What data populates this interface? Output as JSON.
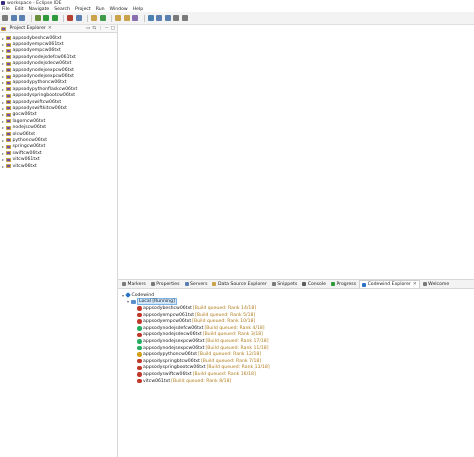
{
  "window": {
    "title": "workspace - Eclipse IDE"
  },
  "menu": [
    "File",
    "Edit",
    "Navigate",
    "Search",
    "Project",
    "Run",
    "Window",
    "Help"
  ],
  "toolbar": {
    "icons": [
      {
        "name": "new-icon",
        "color": "#7a7a7a"
      },
      {
        "name": "save-icon",
        "color": "#5a7fb0"
      },
      {
        "name": "save-all-icon",
        "color": "#5a7fb0"
      },
      {
        "name": "sep"
      },
      {
        "name": "debug-icon",
        "color": "#6b8e3a"
      },
      {
        "name": "run-icon",
        "color": "#2e9a3a"
      },
      {
        "name": "run-config-icon",
        "color": "#2e9a3a"
      },
      {
        "name": "sep"
      },
      {
        "name": "external-tools-icon",
        "color": "#b3402e"
      },
      {
        "name": "new-java-project-icon",
        "color": "#5a7fb0"
      },
      {
        "name": "sep"
      },
      {
        "name": "new-package-icon",
        "color": "#c9a24a"
      },
      {
        "name": "new-class-icon",
        "color": "#3f9a4a"
      },
      {
        "name": "sep"
      },
      {
        "name": "open-type-icon",
        "color": "#c9a24a"
      },
      {
        "name": "open-task-icon",
        "color": "#c9a24a"
      },
      {
        "name": "search-icon",
        "color": "#8a6fb0"
      },
      {
        "name": "sep"
      },
      {
        "name": "web-browser-icon",
        "color": "#4a7fb0"
      },
      {
        "name": "next-annotation-icon",
        "color": "#5a7fb0"
      },
      {
        "name": "prev-annotation-icon",
        "color": "#5a7fb0"
      },
      {
        "name": "back-icon",
        "color": "#7a7a7a"
      },
      {
        "name": "forward-icon",
        "color": "#7a7a7a"
      }
    ]
  },
  "project_explorer": {
    "title": "Project Explorer",
    "close": "✕",
    "projects": [
      "appsodybeshcw06txt",
      "appsodyempcw061txt",
      "appsodyempcw06txt",
      "appsodynodejsdefcw061txt",
      "appsodynodejsdecw06txt",
      "appsodynodejsexpcw06txt",
      "appsodynodejsexpcw06txt",
      "appsodypythoncw06txt",
      "appsodypythonflaskcw06txt",
      "appsodyspringbootcw06txt",
      "appsodyswiftcw06txt",
      "appsodyswiftkitcw06txt",
      "gocw06txt",
      "lagomcw06txt",
      "nodejscw06txt",
      "olcw06txt",
      "pythoncw06txt",
      "springcw06txt",
      "swiftcw06txt",
      "vitcw061txt",
      "vitcw06txt"
    ]
  },
  "bottom_tabs": [
    {
      "label": "Markers",
      "color": "#7a7a7a",
      "active": false
    },
    {
      "label": "Properties",
      "color": "#7a7a7a",
      "active": false
    },
    {
      "label": "Servers",
      "color": "#5a7fb0",
      "active": false
    },
    {
      "label": "Data Source Explorer",
      "color": "#c9a24a",
      "active": false
    },
    {
      "label": "Snippets",
      "color": "#7a7a7a",
      "active": false
    },
    {
      "label": "Console",
      "color": "#5a5a5a",
      "active": false
    },
    {
      "label": "Progress",
      "color": "#2e9a3a",
      "active": false
    },
    {
      "label": "Codewind Explorer",
      "color": "#2d73c4",
      "active": true
    },
    {
      "label": "Welcome",
      "color": "#7a7a7a",
      "active": false
    }
  ],
  "codewind": {
    "root": "Codewind",
    "local_label": "Local [Running]",
    "projects": [
      {
        "name": "appsodybeshcw06txt",
        "status": "[Build queued: Rank 14/18]",
        "color": "#c0392b"
      },
      {
        "name": "appsodyempcw061txt",
        "status": "[Build queued: Rank 5/18]",
        "color": "#c0392b"
      },
      {
        "name": "appsodyempcw06txt",
        "status": "[Build queued: Rank 10/18]",
        "color": "#c0392b"
      },
      {
        "name": "appsodynodejsdefcw06txt",
        "status": "[Build queued: Rank 4/18]",
        "color": "#27ae60"
      },
      {
        "name": "appsodynodejsdecw06txt",
        "status": "[Build queued: Rank 3/18]",
        "color": "#c0392b"
      },
      {
        "name": "appsodynodejsexpcw06txt",
        "status": "[Build queued: Rank 17/18]",
        "color": "#27ae60"
      },
      {
        "name": "appsodynodejsexpcw06txt",
        "status": "[Build queued: Rank 11/18]",
        "color": "#27ae60"
      },
      {
        "name": "appsodypythoncw06txt",
        "status": "[Build queued: Rank 12/18]",
        "color": "#d4a017"
      },
      {
        "name": "appsodyspringbtcw06txt",
        "status": "[Build queued: Rank 7/18]",
        "color": "#c0392b"
      },
      {
        "name": "appsodyspringbootcw06txt",
        "status": "[Build queued: Rank 13/18]",
        "color": "#c0392b"
      },
      {
        "name": "appsodyswiftcw06txt",
        "status": "[Build queued: Rank 16/18]",
        "color": "#c0392b"
      },
      {
        "name": "vitcw061txt",
        "status": "[Build queued: Rank 8/18]",
        "color": "#c0392b"
      }
    ]
  }
}
